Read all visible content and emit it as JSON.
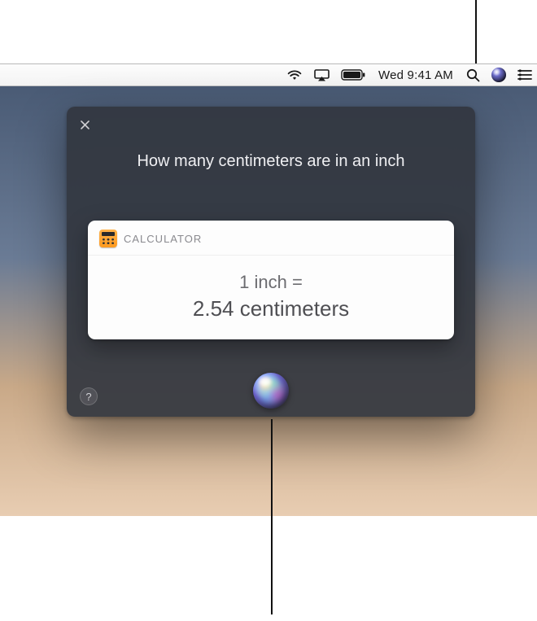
{
  "menubar": {
    "clock": "Wed 9:41 AM"
  },
  "siri": {
    "query": "How many centimeters are in an inch",
    "help_label": "?"
  },
  "result": {
    "source_label": "CALCULATOR",
    "line1": "1 inch =",
    "line2": "2.54 centimeters"
  }
}
